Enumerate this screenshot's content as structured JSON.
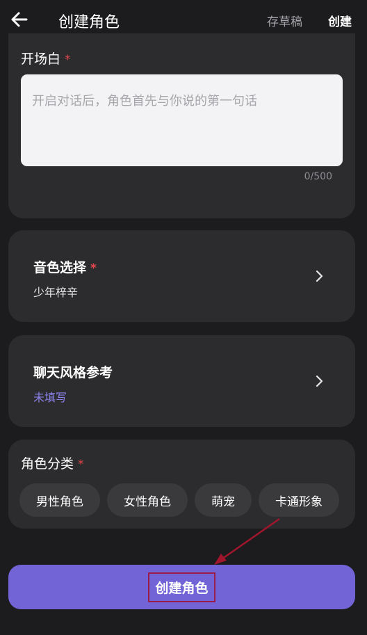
{
  "header": {
    "title": "创建角色",
    "draft_label": "存草稿",
    "create_label": "创建",
    "back_icon": "arrow-left-icon"
  },
  "greeting": {
    "title": "开场白",
    "required_mark": "*",
    "placeholder": "开启对话后，角色首先与你说的第一句话",
    "counter": "0/500"
  },
  "voice": {
    "title": "音色选择",
    "required_mark": "*",
    "value": "少年梓辛",
    "icon": "chevron-right-icon"
  },
  "chat_style": {
    "title": "聊天风格参考",
    "value": "未填写",
    "icon": "chevron-right-icon"
  },
  "category": {
    "title": "角色分类",
    "required_mark": "*",
    "options": [
      "男性角色",
      "女性角色",
      "萌宠",
      "卡通形象"
    ]
  },
  "footer": {
    "create_button_label": "创建角色"
  },
  "colors": {
    "background": "#1c1c1e",
    "card": "#2c2c2e",
    "accent": "#7264d6",
    "accent_text": "#8a80e8",
    "required": "#e5484d",
    "annotation": "#9a1c4a"
  }
}
